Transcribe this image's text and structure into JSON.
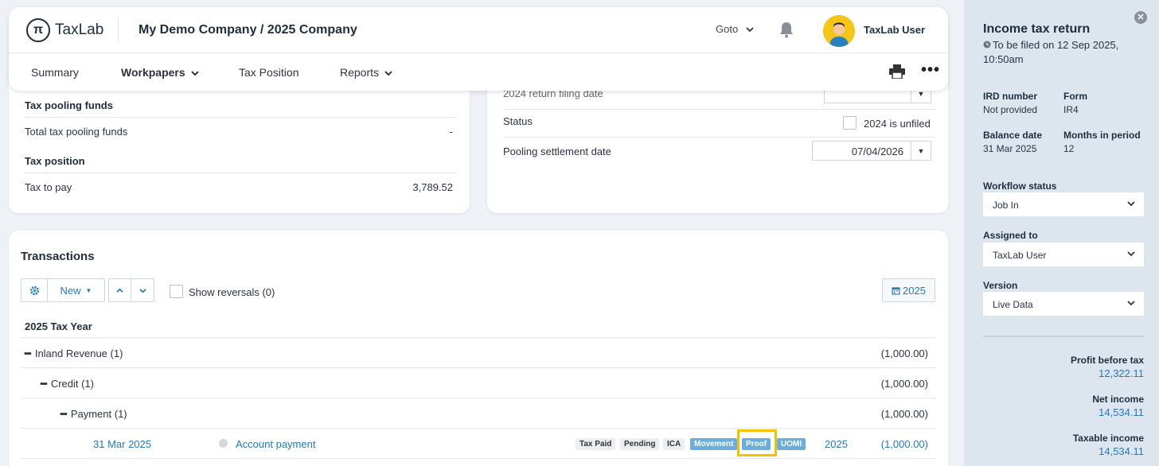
{
  "header": {
    "logo_mark": "π",
    "logo_text": "TaxLab",
    "company": "My Demo Company / 2025 Company",
    "goto_label": "Goto",
    "user_name": "TaxLab User"
  },
  "nav": {
    "items": [
      {
        "label": "Summary"
      },
      {
        "label": "Workpapers"
      },
      {
        "label": "Tax Position"
      },
      {
        "label": "Reports"
      }
    ]
  },
  "left_card": {
    "pooling_heading": "Tax pooling funds",
    "pooling_label": "Total tax pooling funds",
    "pooling_value": "-",
    "position_heading": "Tax position",
    "to_pay_label": "Tax to pay",
    "to_pay_value": "3,789.52"
  },
  "right_card": {
    "filing_date_label": "2024 return filing date",
    "status_label": "Status",
    "status_checkbox_label": "2024 is unfiled",
    "settlement_label": "Pooling settlement date",
    "settlement_value": "07/04/2026"
  },
  "transactions": {
    "title": "Transactions",
    "new_label": "New",
    "show_reversals": "Show reversals (0)",
    "year_button": "2025",
    "tax_year": "2025 Tax Year",
    "groups": [
      {
        "label": "Inland Revenue (1)",
        "amount": "(1,000.00)"
      },
      {
        "label": "Credit (1)",
        "amount": "(1,000.00)"
      },
      {
        "label": "Payment (1)",
        "amount": "(1,000.00)"
      }
    ],
    "row": {
      "date": "31 Mar 2025",
      "description": "Account payment",
      "tags": [
        "Tax Paid",
        "Pending",
        "ICA",
        "Movement",
        "Proof",
        "UOMI"
      ],
      "year": "2025",
      "amount": "(1,000.00)"
    }
  },
  "sidebar": {
    "title": "Income tax return",
    "filed_text": "To be filed on 12 Sep 2025, 10:50am",
    "ird_label": "IRD number",
    "ird_value": "Not provided",
    "form_label": "Form",
    "form_value": "IR4",
    "balance_label": "Balance date",
    "balance_value": "31 Mar 2025",
    "months_label": "Months in period",
    "months_value": "12",
    "workflow_label": "Workflow status",
    "workflow_value": "Job In",
    "assigned_label": "Assigned to",
    "assigned_value": "TaxLab User",
    "version_label": "Version",
    "version_value": "Live Data",
    "profit_label": "Profit before tax",
    "profit_value": "12,322.11",
    "net_label": "Net income",
    "net_value": "14,534.11",
    "taxable_label": "Taxable income",
    "taxable_value": "14,534.11"
  },
  "colors": {
    "accent": "#1f7ac2",
    "highlight": "#f2c200",
    "tag_blue": "#6aaee0"
  }
}
